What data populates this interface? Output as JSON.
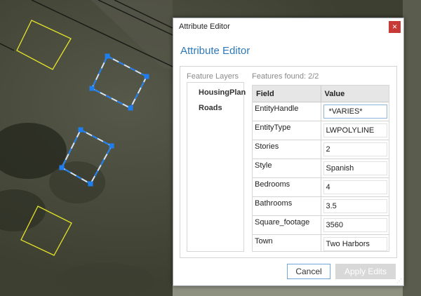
{
  "dialog": {
    "window_title": "Attribute Editor",
    "close_glyph": "×",
    "panel_title": "Attribute Editor",
    "feature_layers_label": "Feature Layers",
    "features_found_label": "Features found: 2/2",
    "layers": [
      "HousingPlan",
      "Roads"
    ],
    "columns": {
      "field": "Field",
      "value": "Value"
    },
    "rows": [
      {
        "field": "EntityHandle",
        "value": "*VARIES*"
      },
      {
        "field": "EntityType",
        "value": "LWPOLYLINE"
      },
      {
        "field": "Stories",
        "value": "2"
      },
      {
        "field": "Style",
        "value": "Spanish"
      },
      {
        "field": "Bedrooms",
        "value": "4"
      },
      {
        "field": "Bathrooms",
        "value": "3.5"
      },
      {
        "field": "Square_footage",
        "value": "3560"
      },
      {
        "field": "Town",
        "value": "Two Harbors"
      }
    ],
    "cancel_label": "Cancel",
    "apply_label": "Apply Edits"
  },
  "colors": {
    "accent": "#2e79b9",
    "close_button": "#c83a36",
    "selection": "#1e7ef0",
    "parcel_outline": "#e5e32a"
  }
}
